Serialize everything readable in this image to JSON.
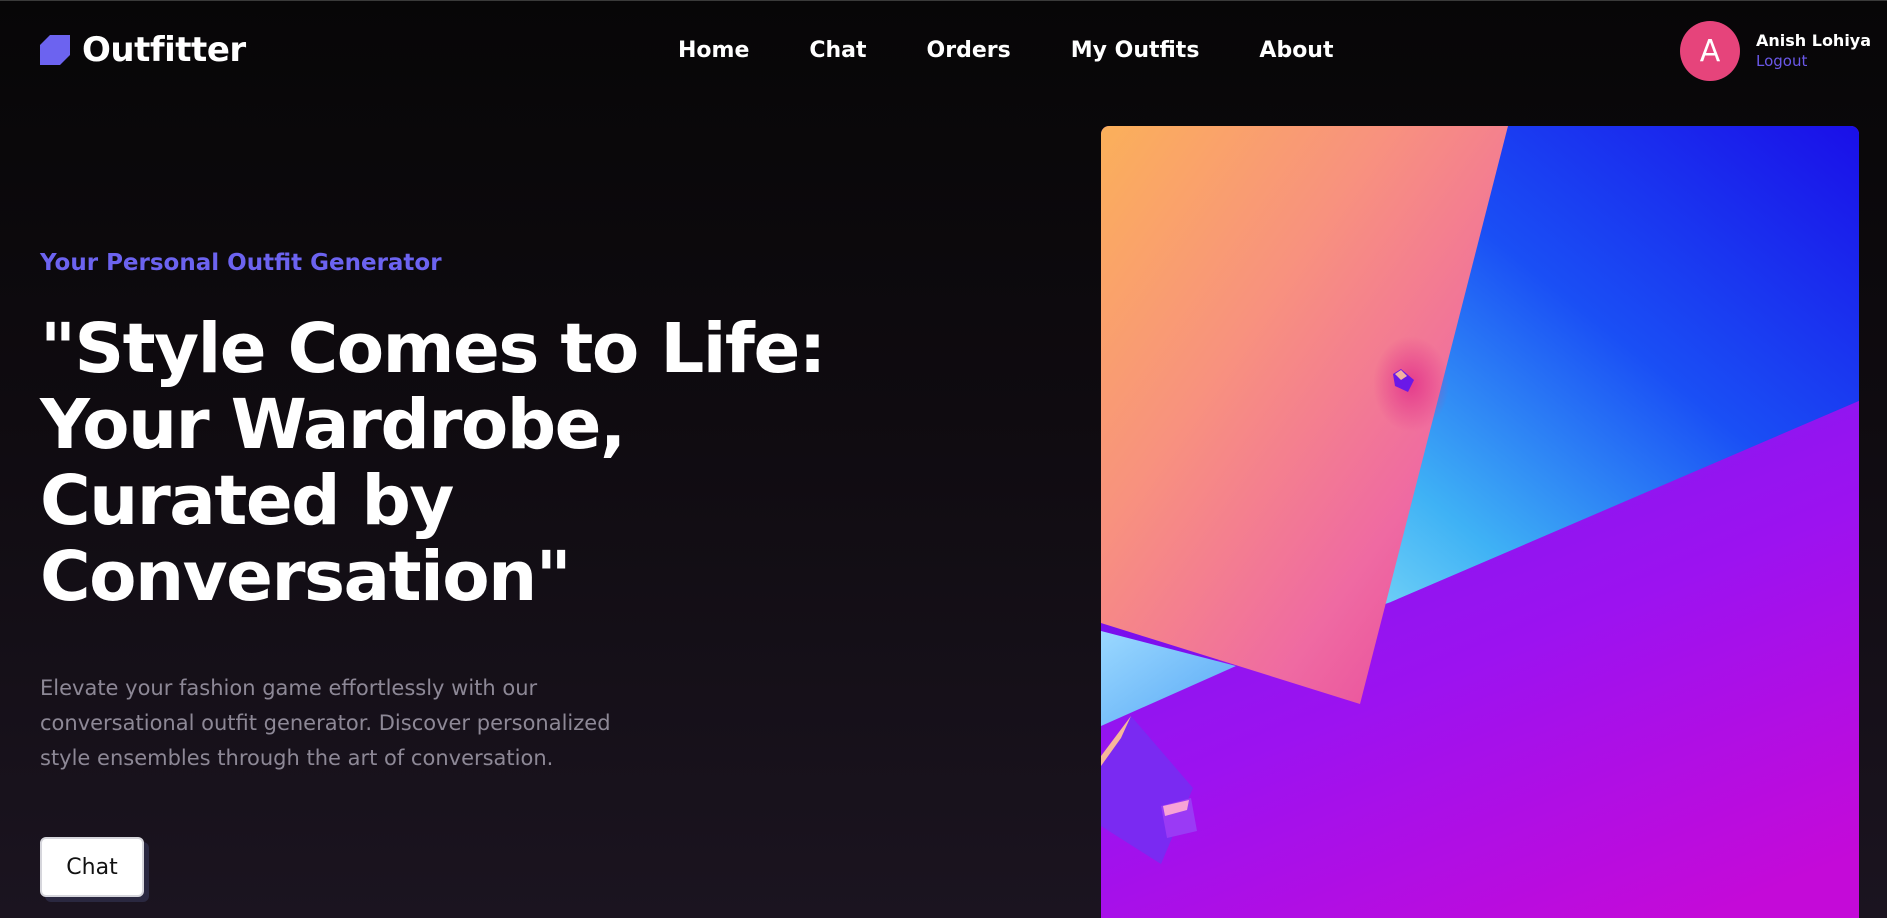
{
  "header": {
    "brand": "Outfitter",
    "nav": [
      {
        "label": "Home"
      },
      {
        "label": "Chat"
      },
      {
        "label": "Orders"
      },
      {
        "label": "My Outfits"
      },
      {
        "label": "About"
      }
    ],
    "user": {
      "avatar_initial": "A",
      "name": "Anish Lohiya",
      "logout_label": "Logout"
    }
  },
  "hero": {
    "eyebrow": "Your Personal Outfit Generator",
    "headline_lines": [
      "\"Style Comes to Life:",
      "Your Wardrobe,",
      "Curated by",
      "Conversation\""
    ],
    "description": "Elevate your fashion game effortlessly with our conversational outfit generator. Discover personalized style ensembles through the art of conversation.",
    "cta_label": "Chat"
  },
  "colors": {
    "accent": "#6c63f0",
    "avatar": "#e6447b",
    "logout": "#6a58e8",
    "background": "#0c090c"
  }
}
